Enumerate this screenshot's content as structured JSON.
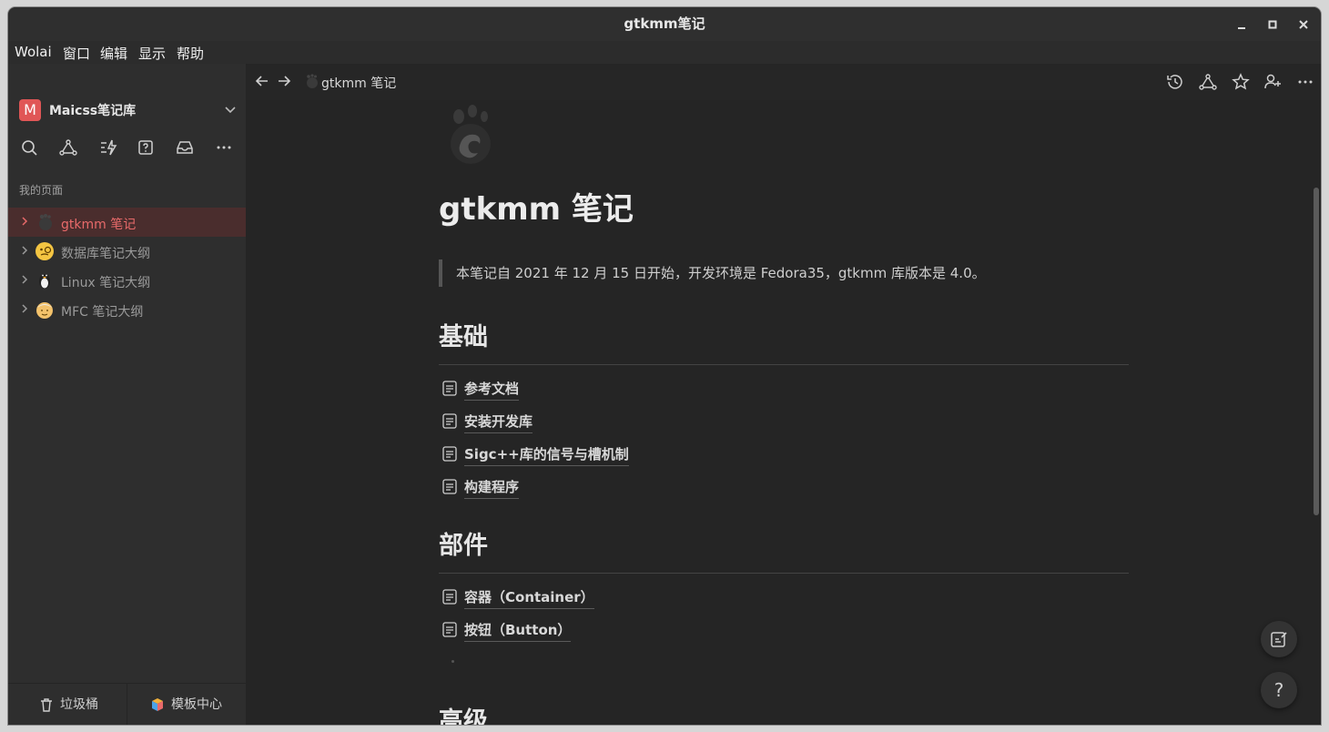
{
  "window": {
    "title": "gtkmm笔记"
  },
  "menu": {
    "items": [
      "Wolai",
      "窗口",
      "编辑",
      "显示",
      "帮助"
    ]
  },
  "sidebar": {
    "workspace_initial": "M",
    "workspace_name": "Maicss笔记库",
    "section_label": "我的页面",
    "items": [
      {
        "label": "gtkmm 笔记",
        "active": true
      },
      {
        "label": "数据库笔记大纲"
      },
      {
        "label": "Linux 笔记大纲"
      },
      {
        "label": "MFC 笔记大纲"
      }
    ],
    "trash_label": "垃圾桶",
    "templates_label": "模板中心"
  },
  "nav": {
    "breadcrumb": "gtkmm 笔记"
  },
  "page": {
    "title": "gtkmm 笔记",
    "quote": "本笔记自 2021 年 12 月 15 日开始，开发环境是 Fedora35，gtkmm 库版本是 4.0。",
    "sections": [
      {
        "heading": "基础",
        "links": [
          "参考文档",
          "安装开发库",
          "Sigc++库的信号与槽机制",
          "构建程序"
        ]
      },
      {
        "heading": "部件",
        "links": [
          "容器（Container）",
          "按钮（Button）"
        ]
      },
      {
        "heading": "高级",
        "links": []
      }
    ]
  },
  "float": {
    "help_label": "?"
  },
  "colors": {
    "accent": "#e86a6a",
    "active_bg": "#4a2d2d",
    "workspace_logo": "#e05656"
  }
}
